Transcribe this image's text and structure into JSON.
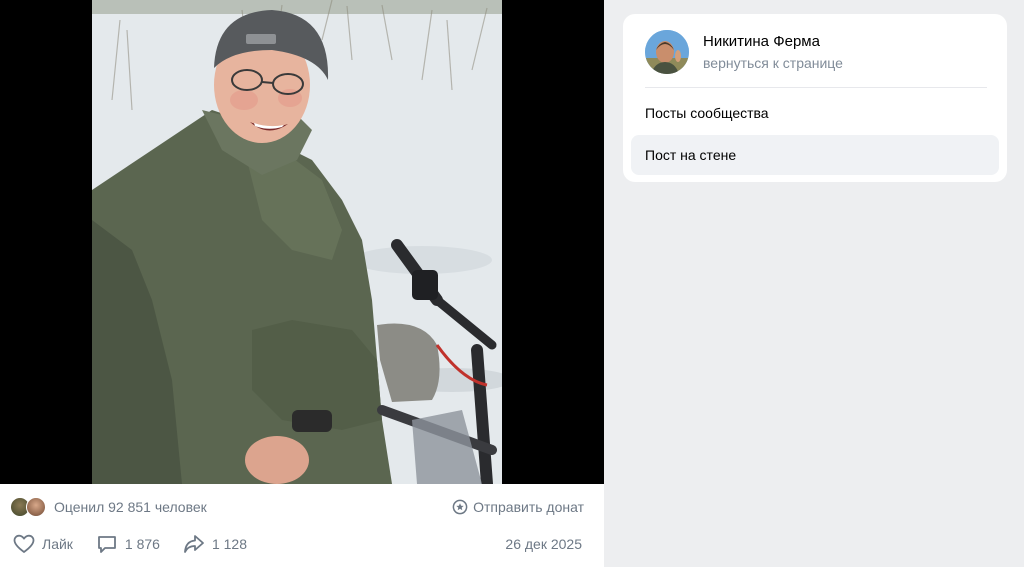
{
  "post": {
    "rated_text": "Оценил 92 851 человек",
    "donate_label": "Отправить донат",
    "like_label": "Лайк",
    "comments_count": "1 876",
    "shares_count": "1 128",
    "date": "26 дек 2025",
    "photo_icon": "photo-of-man-in-snow"
  },
  "sidebar": {
    "owner_name": "Никитина Ферма",
    "back_link": "вернуться к странице",
    "items": [
      {
        "label": "Посты сообщества"
      },
      {
        "label": "Пост на стене"
      }
    ]
  },
  "colors": {
    "page_bg": "#edeef0",
    "muted_text": "#6d7885",
    "active_item_bg": "#f0f2f5"
  }
}
